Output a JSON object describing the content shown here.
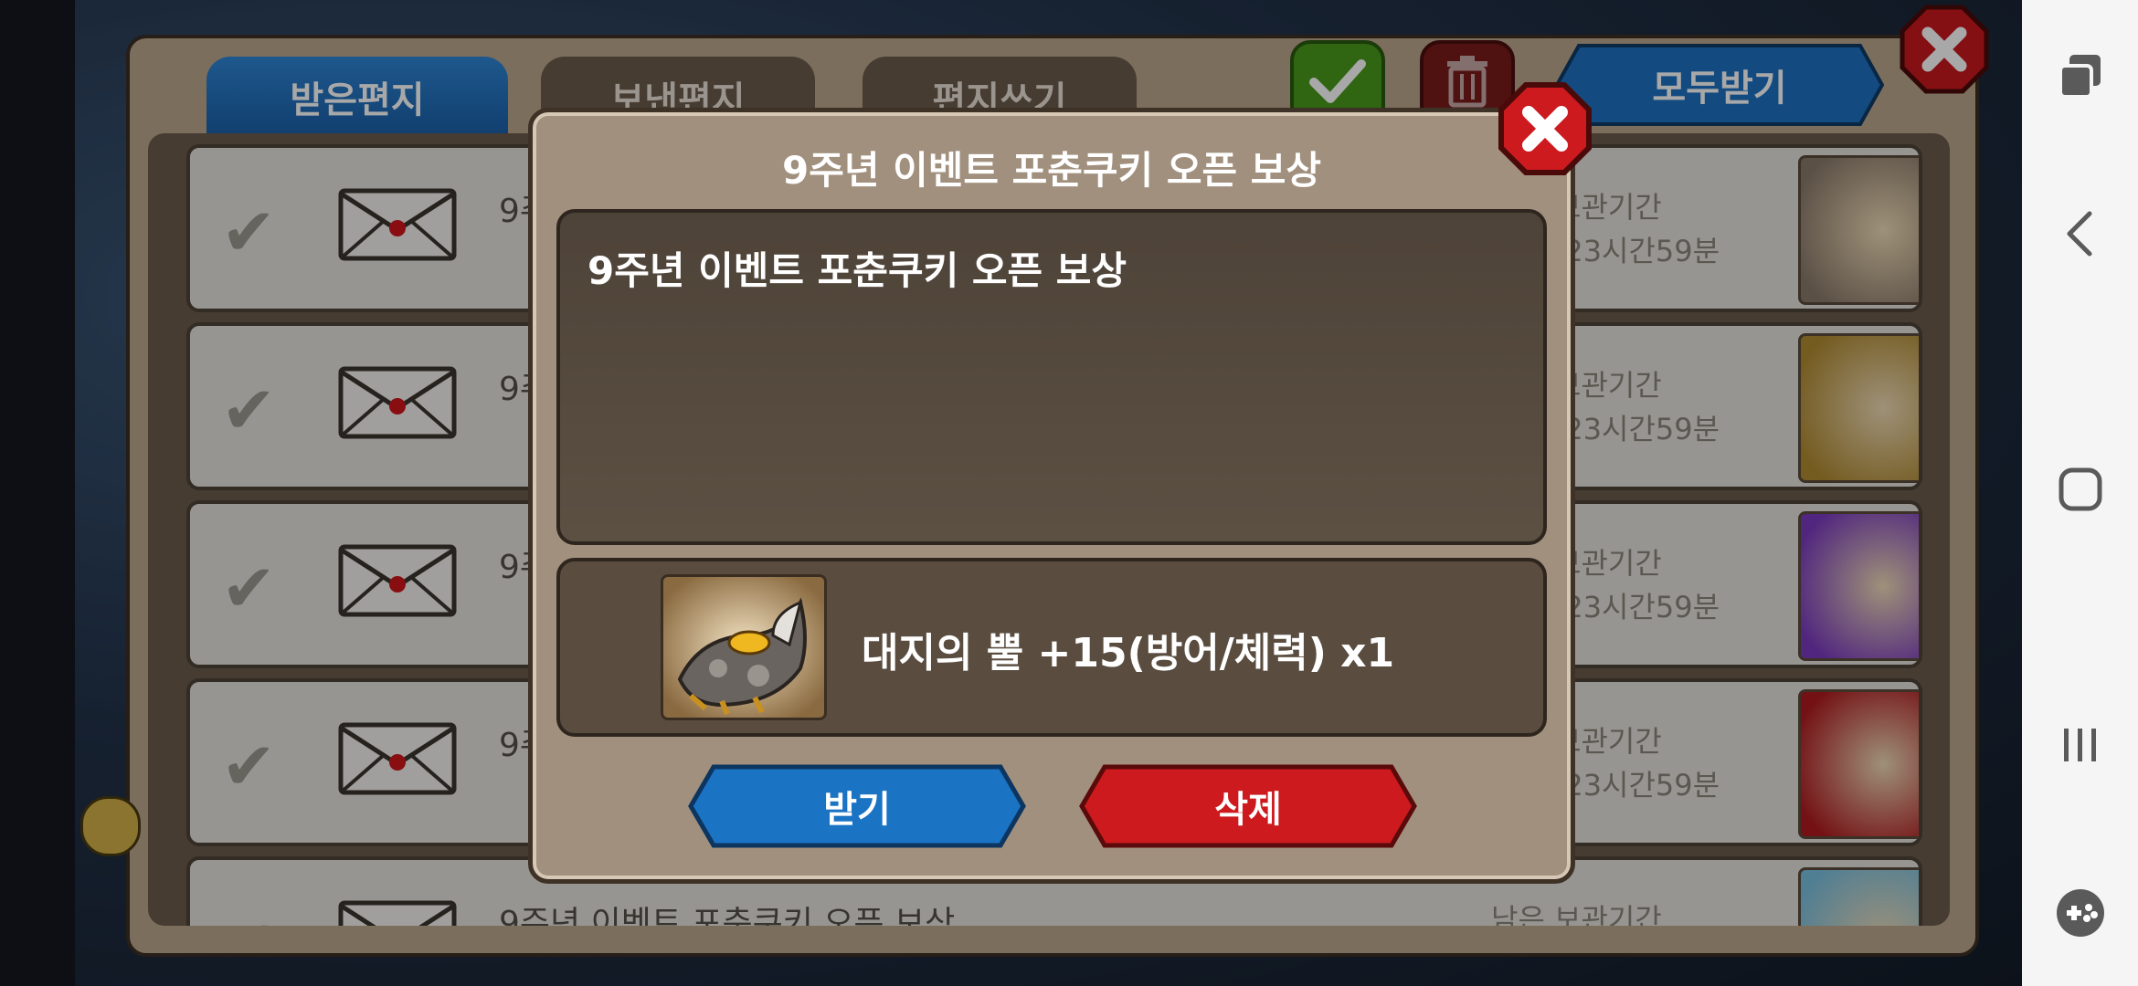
{
  "game": {
    "tabs": {
      "inbox": "받은편지",
      "sent": "보낸편지",
      "compose": "편지쓰기"
    },
    "receive_all_label": "모두받기",
    "mails": [
      {
        "subject": "9주년 이벤트 포춘쿠키 오픈 보상",
        "storage_label": "남은 보관기간",
        "storage_time": "29일 23시간59분",
        "reward_icon": "dragon-gauntlet-icon"
      },
      {
        "subject": "9주년 이벤트 포춘쿠키 오픈 보상",
        "storage_label": "남은 보관기간",
        "storage_time": "29일 23시간59분",
        "reward_icon": "gold-hammer-icon"
      },
      {
        "subject": "9주년 이벤트 포춘쿠키 오픈 보상",
        "storage_label": "남은 보관기간",
        "storage_time": "29일 23시간59분",
        "reward_icon": "purple-crystal-icon"
      },
      {
        "subject": "9주년 이벤트 포춘쿠키 오픈 보상",
        "storage_label": "남은 보관기간",
        "storage_time": "29일 23시간59분",
        "reward_icon": "red-gem-amulet-icon"
      },
      {
        "subject": "9주년 이벤트 포춘쿠키 오픈 보상",
        "storage_label": "남은 보관기간",
        "storage_time": "",
        "reward_icon": "ice-crystal-icon"
      }
    ]
  },
  "modal": {
    "title": "9주년 이벤트 포춘쿠키 오픈 보상",
    "message": "9주년 이벤트 포춘쿠키 오픈 보상",
    "reward_text": "대지의 뿔 +15(방어/체력) x1",
    "reward_icon": "earth-horn-icon",
    "receive_label": "받기",
    "delete_label": "삭제"
  },
  "colors": {
    "blue_button": "#1a6fbf",
    "red_button": "#c8191e",
    "green_button": "#4a9a1c",
    "panel": "#bda88c",
    "modal": "#a1907d"
  }
}
